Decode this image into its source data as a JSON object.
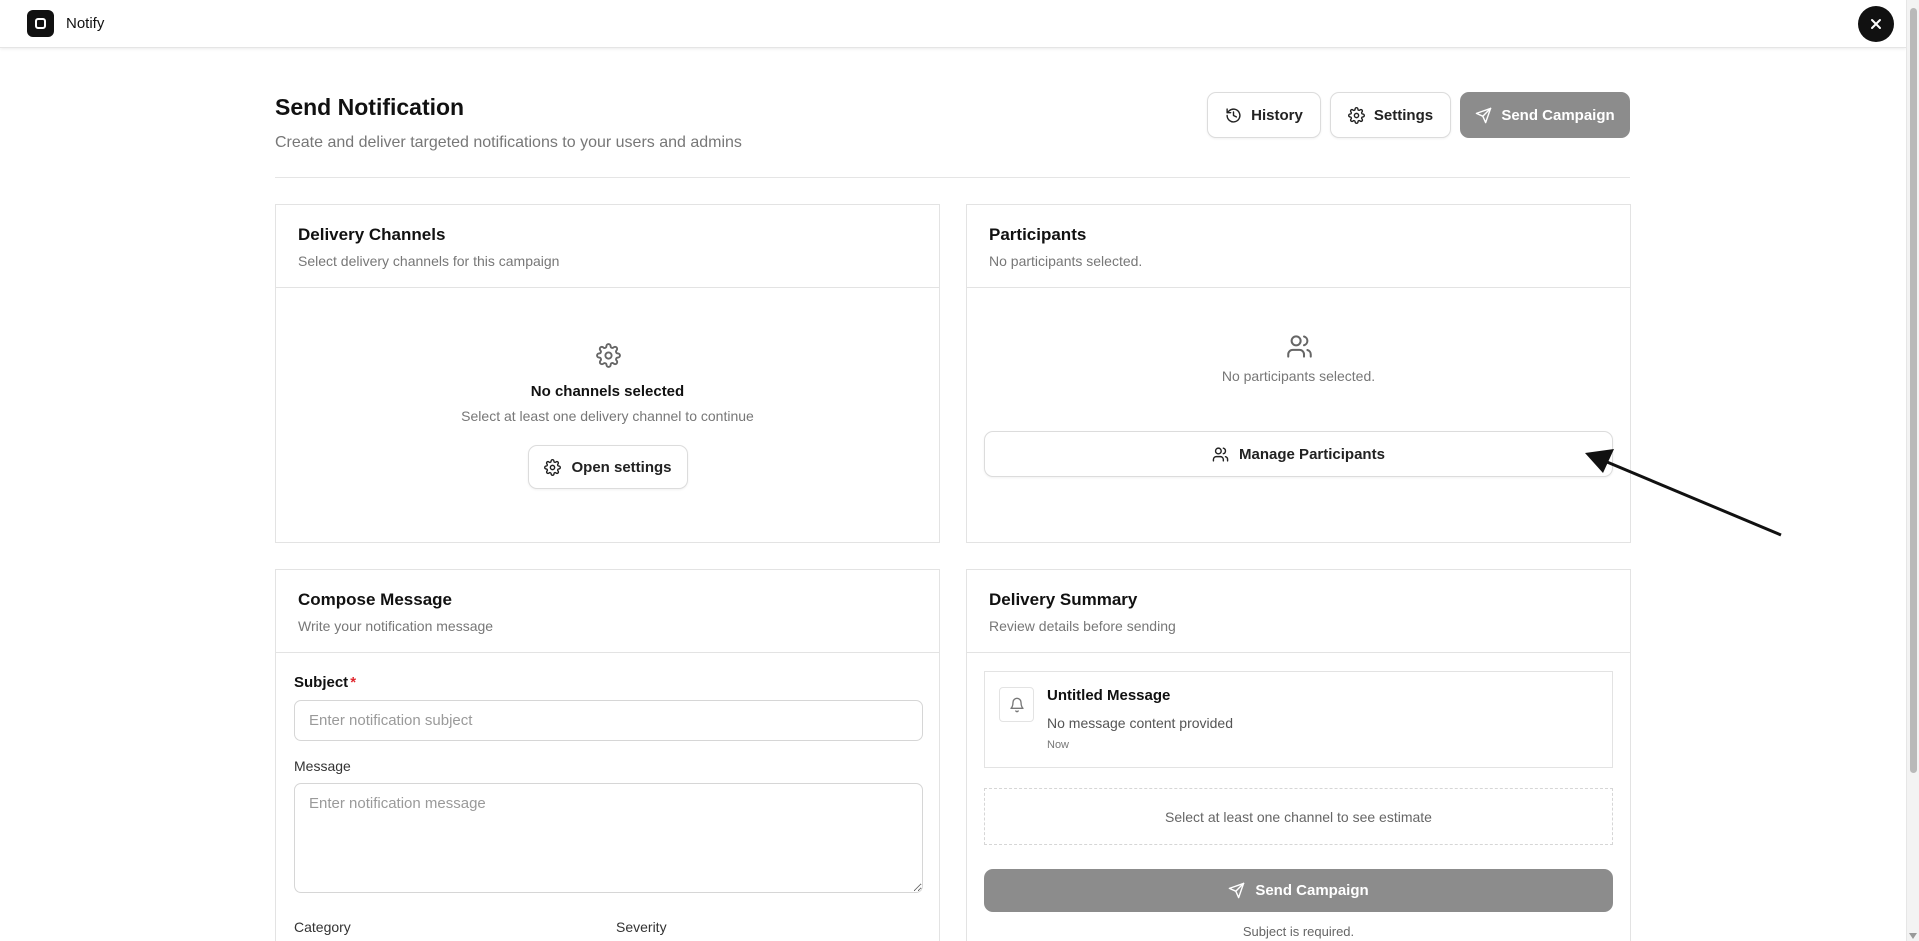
{
  "app": {
    "name": "Notify",
    "logo_icon": "app-logo-icon",
    "close_icon": "close-icon"
  },
  "header": {
    "title": "Send Notification",
    "subtitle": "Create and deliver targeted notifications to your users and admins",
    "buttons": {
      "history": "History",
      "settings": "Settings",
      "send_campaign": "Send Campaign"
    }
  },
  "delivery_channels": {
    "title": "Delivery Channels",
    "subtitle": "Select delivery channels for this campaign",
    "empty_title": "No channels selected",
    "empty_sub": "Select at least one delivery channel to continue",
    "open_settings": "Open settings"
  },
  "participants": {
    "title": "Participants",
    "subtitle": "No participants selected.",
    "empty_text": "No participants selected.",
    "manage_button": "Manage Participants"
  },
  "compose": {
    "title": "Compose Message",
    "subtitle": "Write your notification message",
    "subject_label": "Subject",
    "subject_required": "*",
    "subject_placeholder": "Enter notification subject",
    "subject_value": "",
    "message_label": "Message",
    "message_placeholder": "Enter notification message",
    "message_value": "",
    "category_label": "Category",
    "severity_label": "Severity"
  },
  "summary": {
    "title": "Delivery Summary",
    "subtitle": "Review details before sending",
    "preview_title": "Untitled Message",
    "preview_body": "No message content provided",
    "preview_time": "Now",
    "estimate_text": "Select at least one channel to see estimate",
    "send_button": "Send Campaign",
    "requirement_note": "Subject is required."
  },
  "colors": {
    "primary_disabled": "#8c8c8c",
    "required": "#e0282f",
    "text_muted": "#777777"
  }
}
